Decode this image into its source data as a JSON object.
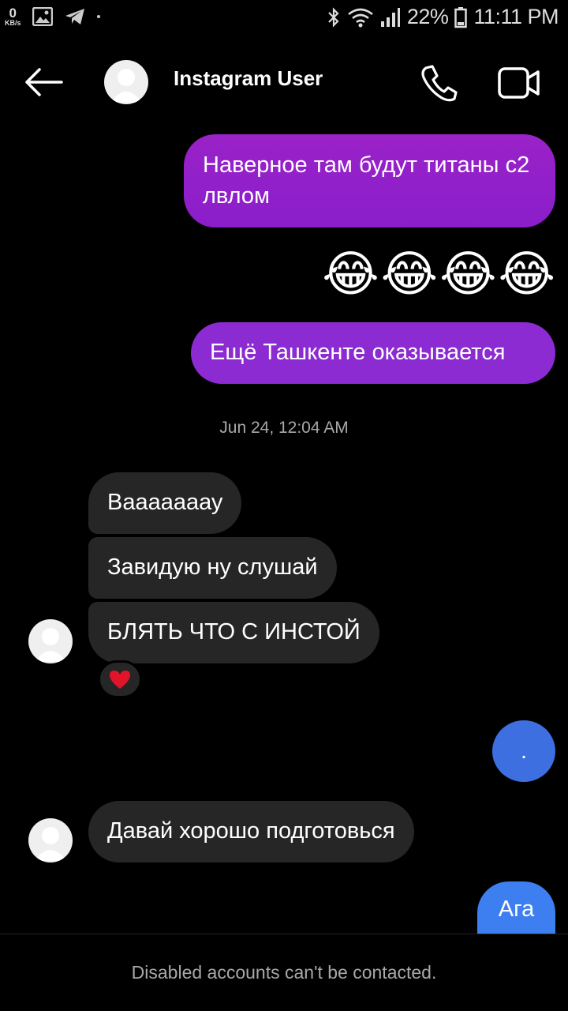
{
  "status_bar": {
    "speed_value": "0",
    "speed_unit": "KB/s",
    "battery": "22%",
    "time": "11:11 PM",
    "icons": [
      "gallery-icon",
      "telegram-icon",
      "bluetooth-icon",
      "wifi-icon",
      "signal-icon",
      "battery-icon"
    ]
  },
  "header": {
    "title": "Instagram User",
    "icons": [
      "back-arrow-icon",
      "default-avatar-icon",
      "phone-icon",
      "video-camera-icon"
    ]
  },
  "messages": {
    "out_1": "Наверное там будут титаны с2 лвлом",
    "emojis": [
      "😂",
      "😂",
      "😂",
      "😂"
    ],
    "out_2": "Ещё Ташкенте оказывается",
    "timestamp": "Jun 24, 12:04 AM",
    "in_1": "Вааааааау",
    "in_2": "Завидую ну слушай",
    "in_3": "БЛЯТЬ ЧТО С ИНСТОЙ",
    "reaction": "❤️",
    "out_3": ".",
    "in_4": "Давай хорошо подготовься",
    "out_4": "Ага"
  },
  "colors": {
    "background": "#000000",
    "outgoing_purple": "#8b2bd1",
    "outgoing_blue": "#3d7ff0",
    "incoming": "#262626",
    "secondary_text": "#a8a8a8"
  },
  "footer": {
    "notice": "Disabled accounts can't be contacted."
  }
}
